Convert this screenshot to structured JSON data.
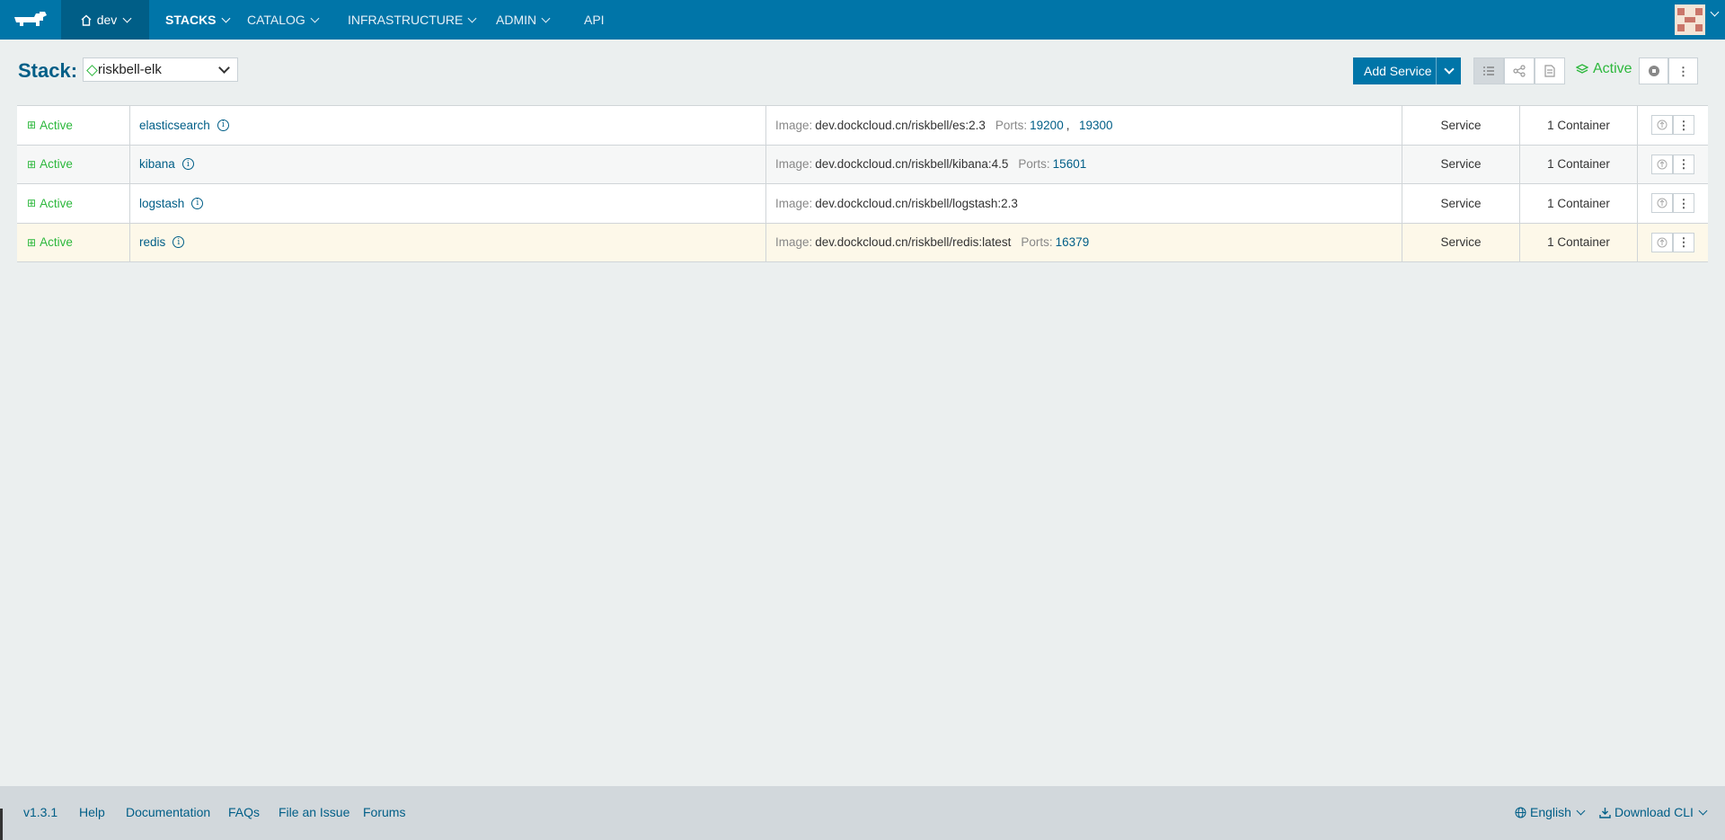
{
  "nav": {
    "env_label": "dev",
    "items": [
      {
        "label": "STACKS",
        "active": true
      },
      {
        "label": "CATALOG",
        "active": false
      },
      {
        "label": "INFRASTRUCTURE",
        "active": false
      },
      {
        "label": "ADMIN",
        "active": false
      },
      {
        "label": "API",
        "active": false
      }
    ]
  },
  "header": {
    "stack_label": "Stack:",
    "stack_value": "riskbell-elk",
    "add_service_label": "Add Service",
    "status": "Active"
  },
  "services": [
    {
      "status": "Active",
      "name": "elasticsearch",
      "image_label": "Image:",
      "image": "dev.dockcloud.cn/riskbell/es:2.3",
      "ports_label": "Ports:",
      "ports": [
        "19200",
        "19300"
      ],
      "kind": "Service",
      "scale": "1 Container"
    },
    {
      "status": "Active",
      "name": "kibana",
      "image_label": "Image:",
      "image": "dev.dockcloud.cn/riskbell/kibana:4.5",
      "ports_label": "Ports:",
      "ports": [
        "15601"
      ],
      "kind": "Service",
      "scale": "1 Container"
    },
    {
      "status": "Active",
      "name": "logstash",
      "image_label": "Image:",
      "image": "dev.dockcloud.cn/riskbell/logstash:2.3",
      "ports_label": "",
      "ports": [],
      "kind": "Service",
      "scale": "1 Container"
    },
    {
      "status": "Active",
      "name": "redis",
      "image_label": "Image:",
      "image": "dev.dockcloud.cn/riskbell/redis:latest",
      "ports_label": "Ports:",
      "ports": [
        "16379"
      ],
      "kind": "Service",
      "scale": "1 Container"
    }
  ],
  "footer": {
    "version": "v1.3.1",
    "links": [
      "Help",
      "Documentation",
      "FAQs",
      "File an Issue",
      "Forums"
    ],
    "language": "English",
    "download": "Download CLI"
  },
  "colors": {
    "nav_bg": "#0075a8",
    "env_bg": "#005e87",
    "active_green": "#2db83d",
    "link_blue": "#005e87",
    "page_bg": "#ebefef",
    "footer_bg": "#d2d8dc"
  }
}
